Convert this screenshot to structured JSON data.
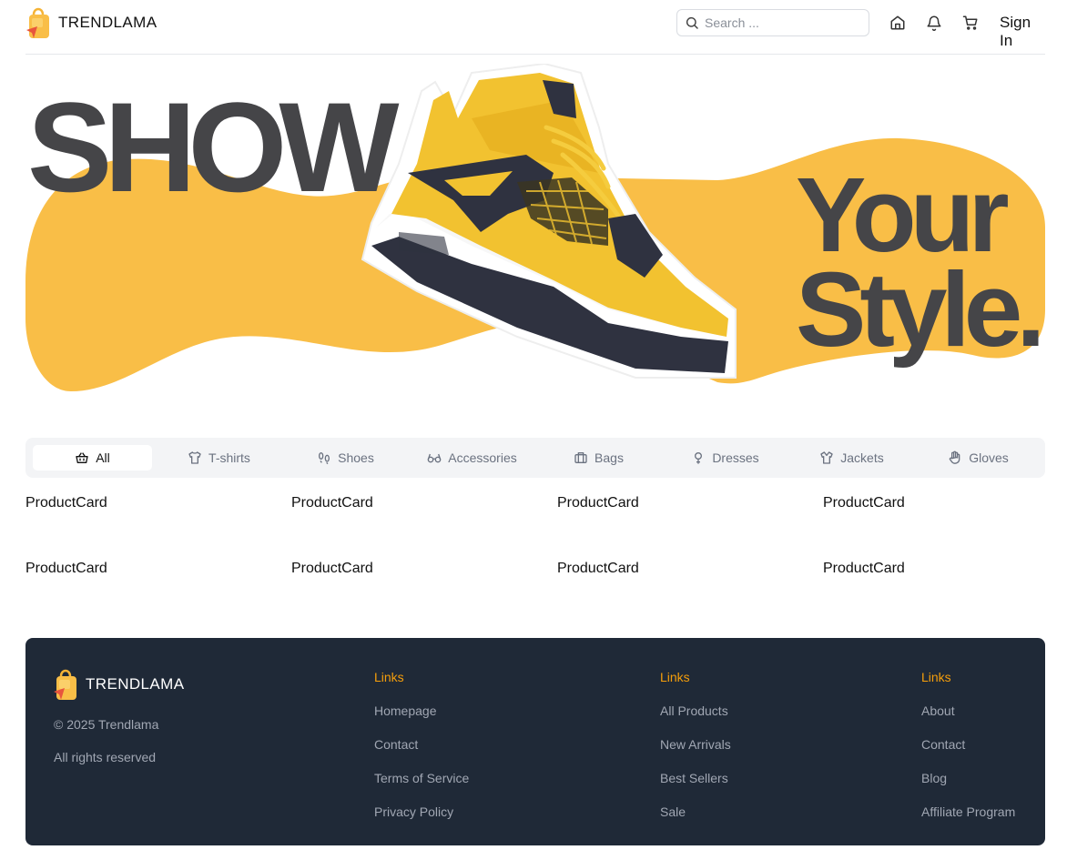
{
  "header": {
    "brand": "TRENDLAMA",
    "search_placeholder": "Search ...",
    "sign_in": "Sign In",
    "icons": [
      "home-icon",
      "bell-icon",
      "cart-icon"
    ]
  },
  "hero": {
    "line1": "SHOW",
    "line2": "Your",
    "line3": "Style."
  },
  "categories": [
    {
      "label": "All",
      "icon": "basket-icon",
      "active": true
    },
    {
      "label": "T-shirts",
      "icon": "tshirt-icon"
    },
    {
      "label": "Shoes",
      "icon": "footprints-icon"
    },
    {
      "label": "Accessories",
      "icon": "glasses-icon"
    },
    {
      "label": "Bags",
      "icon": "briefcase-icon"
    },
    {
      "label": "Dresses",
      "icon": "venus-icon"
    },
    {
      "label": "Jackets",
      "icon": "shirt-icon"
    },
    {
      "label": "Gloves",
      "icon": "hand-icon"
    }
  ],
  "products": [
    "ProductCard",
    "ProductCard",
    "ProductCard",
    "ProductCard",
    "ProductCard",
    "ProductCard",
    "ProductCard",
    "ProductCard"
  ],
  "footer": {
    "brand": "TRENDLAMA",
    "copyright": "© 2025 Trendlama",
    "rights": "All rights reserved",
    "columns": [
      {
        "heading": "Links",
        "links": [
          "Homepage",
          "Contact",
          "Terms of Service",
          "Privacy Policy"
        ]
      },
      {
        "heading": "Links",
        "links": [
          "All Products",
          "New Arrivals",
          "Best Sellers",
          "Sale"
        ]
      },
      {
        "heading": "Links",
        "links": [
          "About",
          "Contact",
          "Blog",
          "Affiliate Program"
        ]
      }
    ]
  },
  "colors": {
    "accent": "#f9be47",
    "hero_text": "#454548",
    "footer_bg": "#1f2937",
    "footer_heading": "#f59e0b"
  }
}
